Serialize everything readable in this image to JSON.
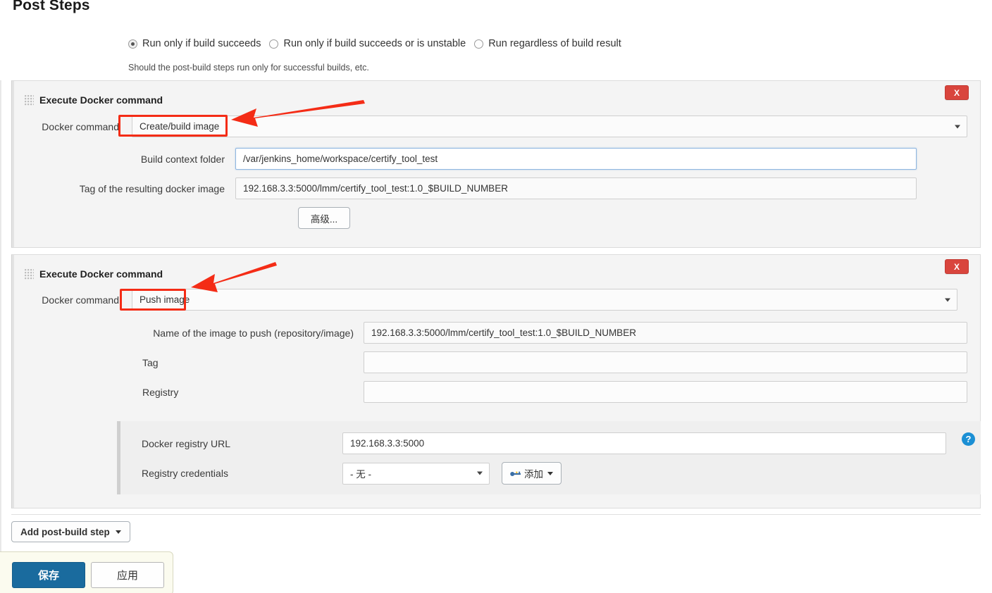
{
  "page": {
    "title": "Post Steps",
    "help_note": "Should the post-build steps run only for successful builds, etc."
  },
  "run_condition": {
    "options": [
      {
        "label": "Run only if build succeeds",
        "selected": true
      },
      {
        "label": "Run only if build succeeds or is unstable",
        "selected": false
      },
      {
        "label": "Run regardless of build result",
        "selected": false
      }
    ]
  },
  "steps": [
    {
      "title": "Execute Docker command",
      "delete_label": "X",
      "command_label": "Docker command",
      "command_value": "Create/build image",
      "fields": [
        {
          "label": "Build context folder",
          "value": "/var/jenkins_home/workspace/certify_tool_test",
          "focused": true
        },
        {
          "label": "Tag of the resulting docker image",
          "value": "192.168.3.3:5000/lmm/certify_tool_test:1.0_$BUILD_NUMBER",
          "focused": false
        }
      ],
      "advanced_label": "高级..."
    },
    {
      "title": "Execute Docker command",
      "delete_label": "X",
      "command_label": "Docker command",
      "command_value": "Push image",
      "fields": [
        {
          "label": "Name of the image to push (repository/image)",
          "value": "192.168.3.3:5000/lmm/certify_tool_test:1.0_$BUILD_NUMBER",
          "focused": false
        },
        {
          "label": "Tag",
          "value": "",
          "focused": false
        },
        {
          "label": "Registry",
          "value": "",
          "focused": false
        }
      ],
      "registry": {
        "url_label": "Docker registry URL",
        "url_value": "192.168.3.3:5000",
        "credentials_label": "Registry credentials",
        "credentials_value": "- 无 -",
        "add_label": "添加",
        "help_glyph": "?"
      }
    }
  ],
  "footer": {
    "add_post_build_step": "Add post-build step",
    "save": "保存",
    "apply": "应用"
  },
  "annotations": {
    "colors": {
      "highlight": "#f42c16",
      "accent": "#1a6b9e",
      "danger": "#d9453d",
      "help": "#1b8fd4"
    }
  }
}
